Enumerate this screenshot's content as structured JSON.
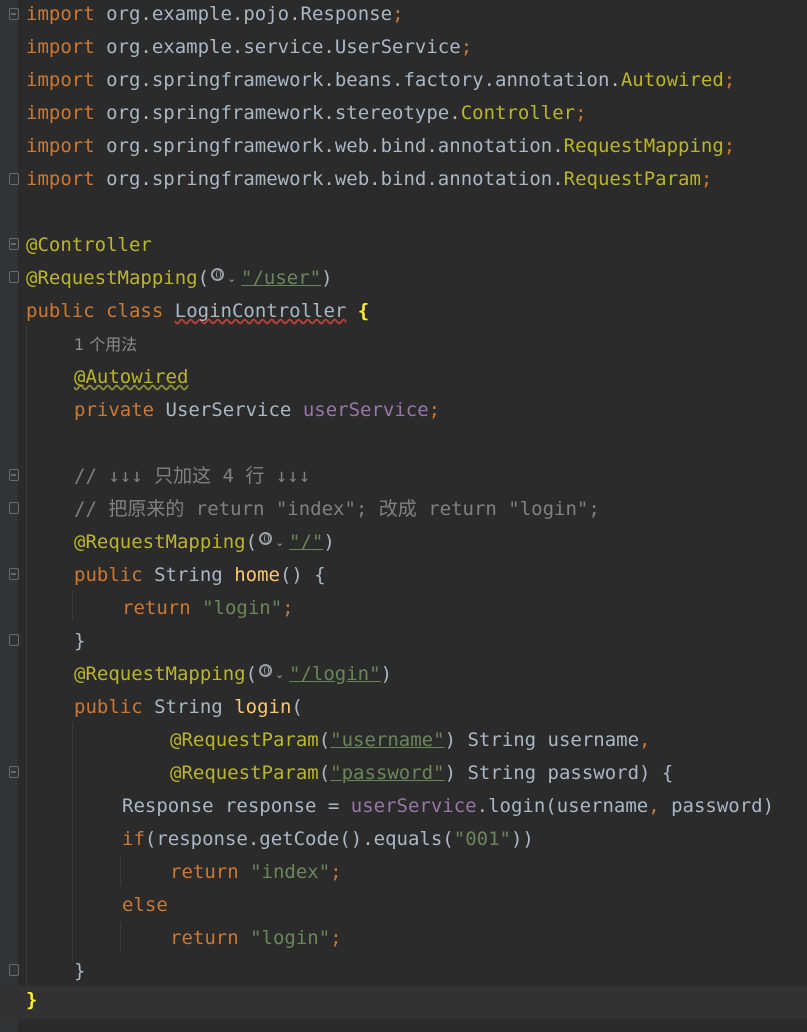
{
  "lines": [
    {
      "kw": "import",
      "pkg": " org.example.pojo.",
      "cls": "Response",
      "end": ";"
    },
    {
      "kw": "import",
      "pkg": " org.example.service.",
      "cls": "UserService",
      "end": ";"
    },
    {
      "kw": "import",
      "pkg": " org.springframework.beans.factory.annotation.",
      "cls": "Autowired",
      "end": ";"
    },
    {
      "kw": "import",
      "pkg": " org.springframework.stereotype.",
      "cls": "Controller",
      "end": ";"
    },
    {
      "kw": "import",
      "pkg": " org.springframework.web.bind.annotation.",
      "cls": "RequestMapping",
      "end": ";"
    },
    {
      "kw": "import",
      "pkg": " org.springframework.web.bind.annotation.",
      "cls": "RequestParam",
      "end": ";"
    }
  ],
  "class_section": {
    "annotation_controller": "@Controller",
    "annotation_request_mapping": "@RequestMapping",
    "user_path": "\"/user\"",
    "public": "public",
    "class": "class",
    "class_name": "LoginController",
    "open_brace": "{",
    "usage_hint": "1 个用法",
    "autowired": "@Autowired",
    "private": "private",
    "field_type": "UserService",
    "field_name": "userService",
    "semicolon": ";"
  },
  "comments": {
    "line1": "// ↓↓↓ 只加这 4 行 ↓↓↓",
    "line2": "// 把原来的 return \"index\"; 改成 return \"login\";"
  },
  "home_method": {
    "annotation": "@RequestMapping",
    "path": "\"/\"",
    "public": "public",
    "ret_type": "String",
    "name": "home",
    "params": "() {",
    "return_kw": "return",
    "return_val": "\"login\"",
    "close": "}"
  },
  "login_method": {
    "annotation": "@RequestMapping",
    "path": "\"/login\"",
    "public": "public",
    "ret_type": "String",
    "name": "login",
    "open_paren": "(",
    "param_annotation": "@RequestParam",
    "param1_name_str": "\"username\"",
    "param1_decl": ") String username",
    "comma": ",",
    "param2_name_str": "\"password\"",
    "param2_decl": ") String password) {",
    "stmt1_type": "Response response = ",
    "stmt1_field": "userService",
    "stmt1_call": ".login(username",
    "stmt1_args": " password)",
    "if_kw": "if",
    "if_cond": "(response.getCode().equals(",
    "if_str": "\"001\"",
    "if_close": "))",
    "return_kw": "return",
    "return_index": "\"index\"",
    "else_kw": "else",
    "return_login": "\"login\"",
    "close": "}"
  },
  "class_close": "}"
}
